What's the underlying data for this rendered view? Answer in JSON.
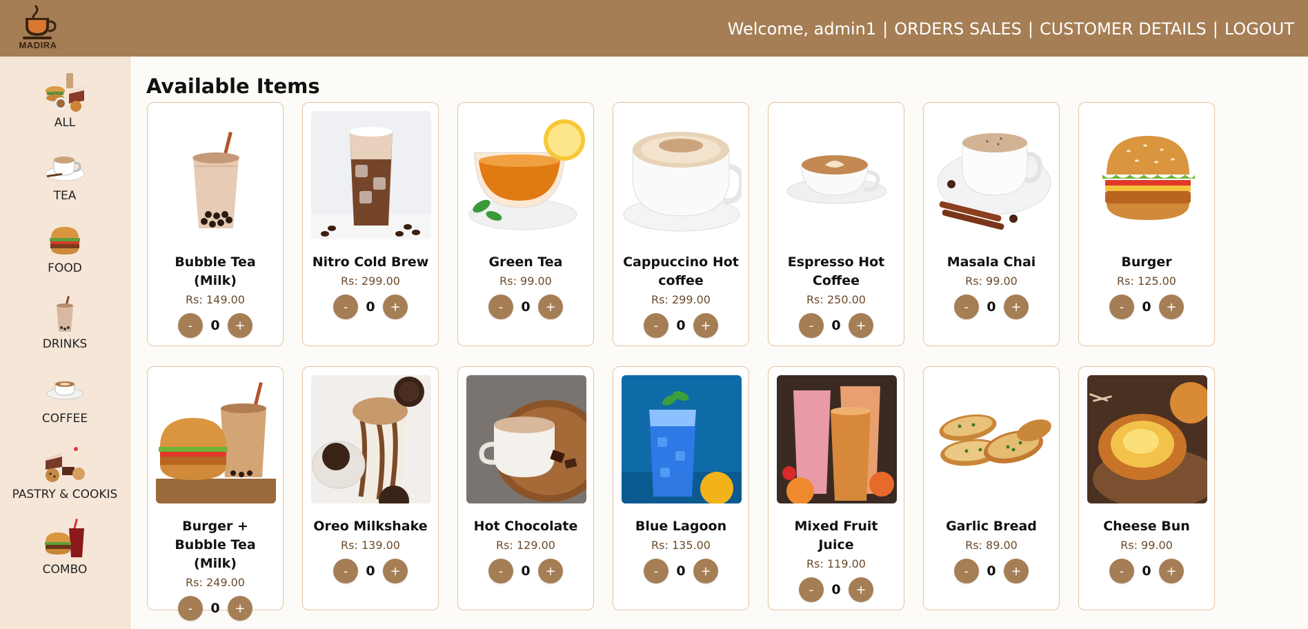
{
  "brand": {
    "logo_text": "MADIRA",
    "accent": "#a57e55"
  },
  "header": {
    "welcome": "Welcome, admin1",
    "sep": "|",
    "links": [
      "ORDERS SALES",
      "CUSTOMER DETAILS",
      "LOGOUT"
    ]
  },
  "sidebar": {
    "categories": [
      {
        "label": "ALL",
        "icon": "all-items-icon"
      },
      {
        "label": "TEA",
        "icon": "tea-cup-icon"
      },
      {
        "label": "FOOD",
        "icon": "burger-icon"
      },
      {
        "label": "DRINKS",
        "icon": "bubble-tea-icon"
      },
      {
        "label": "COFFEE",
        "icon": "coffee-cup-icon"
      },
      {
        "label": "PASTRY & COOKIS",
        "icon": "pastry-icon"
      },
      {
        "label": "COMBO",
        "icon": "combo-icon"
      }
    ]
  },
  "main": {
    "title": "Available Items",
    "items": [
      {
        "name": "Bubble Tea (Milk)",
        "price": "Rs: 149.00",
        "qty": "0",
        "image": "bubble-tea-image"
      },
      {
        "name": "Nitro Cold Brew",
        "price": "Rs: 299.00",
        "qty": "0",
        "image": "cold-brew-image"
      },
      {
        "name": "Green Tea",
        "price": "Rs: 99.00",
        "qty": "0",
        "image": "green-tea-image"
      },
      {
        "name": "Cappuccino Hot coffee",
        "price": "Rs: 299.00",
        "qty": "0",
        "image": "cappuccino-image"
      },
      {
        "name": "Espresso Hot Coffee",
        "price": "Rs: 250.00",
        "qty": "0",
        "image": "espresso-image"
      },
      {
        "name": "Masala Chai",
        "price": "Rs: 99.00",
        "qty": "0",
        "image": "masala-chai-image"
      },
      {
        "name": "Burger",
        "price": "Rs: 125.00",
        "qty": "0",
        "image": "burger-image"
      },
      {
        "name": "Burger + Bubble Tea (Milk)",
        "price": "Rs: 249.00",
        "qty": "0",
        "image": "burger-combo-image"
      },
      {
        "name": "Oreo Milkshake",
        "price": "Rs: 139.00",
        "qty": "0",
        "image": "oreo-milkshake-image"
      },
      {
        "name": "Hot Chocolate",
        "price": "Rs: 129.00",
        "qty": "0",
        "image": "hot-chocolate-image"
      },
      {
        "name": "Blue Lagoon",
        "price": "Rs: 135.00",
        "qty": "0",
        "image": "blue-lagoon-image"
      },
      {
        "name": "Mixed Fruit Juice",
        "price": "Rs: 119.00",
        "qty": "0",
        "image": "fruit-juice-image"
      },
      {
        "name": "Garlic Bread",
        "price": "Rs: 89.00",
        "qty": "0",
        "image": "garlic-bread-image"
      },
      {
        "name": "Cheese Bun",
        "price": "Rs: 99.00",
        "qty": "0",
        "image": "cheese-bun-image"
      }
    ],
    "minus_label": "-",
    "plus_label": "+"
  }
}
